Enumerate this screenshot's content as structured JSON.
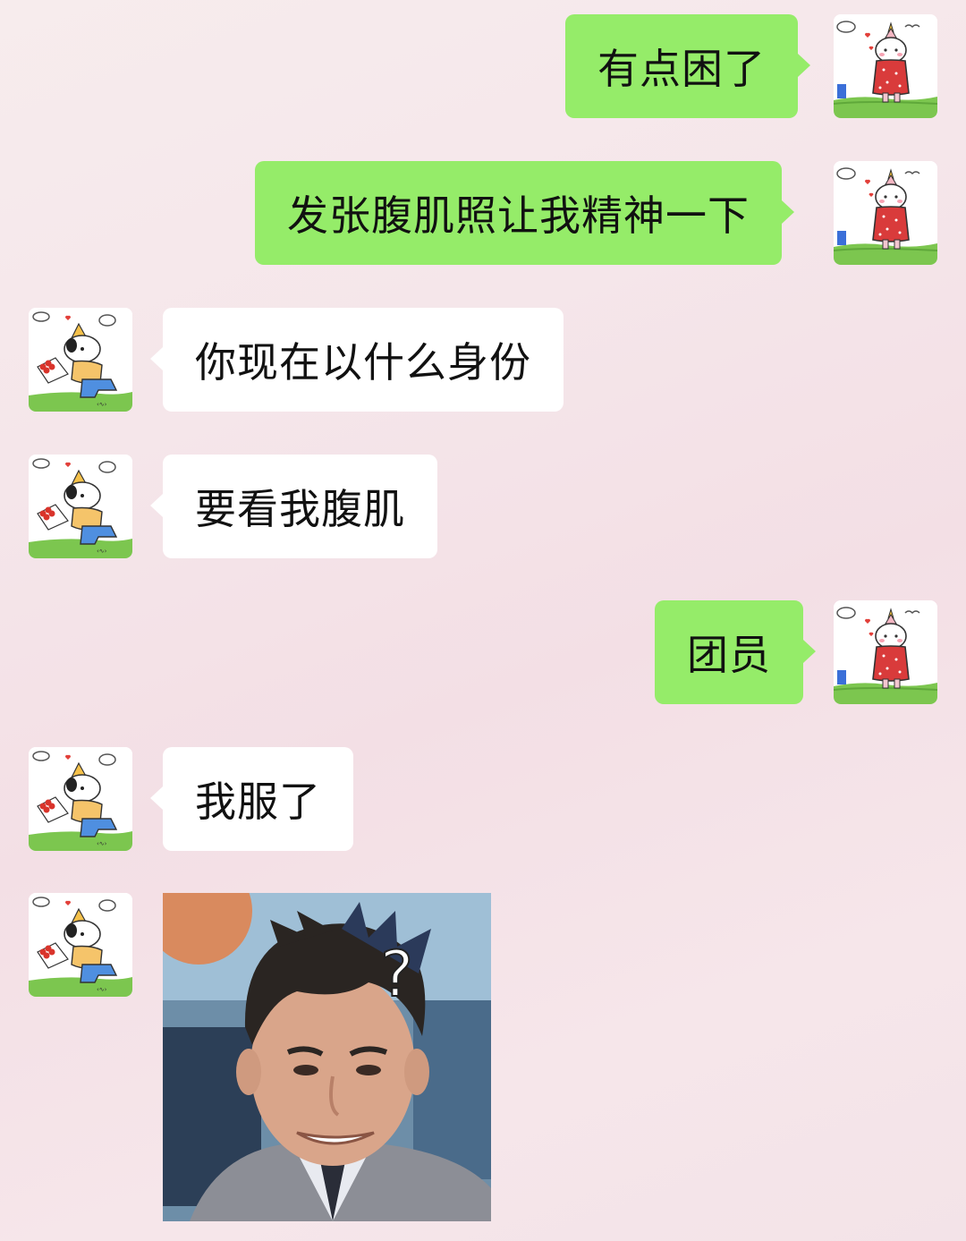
{
  "chat": {
    "messages": [
      {
        "sender": "me",
        "text": "有点困了"
      },
      {
        "sender": "me",
        "text": "发张腹肌照让我精神一下"
      },
      {
        "sender": "them",
        "text": "你现在以什么身份"
      },
      {
        "sender": "them",
        "text": "要看我腹肌"
      },
      {
        "sender": "me",
        "text": "团员"
      },
      {
        "sender": "them",
        "text": "我服了"
      },
      {
        "sender": "them",
        "type": "sticker",
        "sticker": "confused-man-question-mark",
        "overlay_text": "?"
      }
    ]
  },
  "avatars": {
    "me": "cat-in-red-dress-avatar",
    "them": "dog-with-flowers-avatar"
  },
  "colors": {
    "my_bubble": "#95ec69",
    "their_bubble": "#ffffff"
  }
}
